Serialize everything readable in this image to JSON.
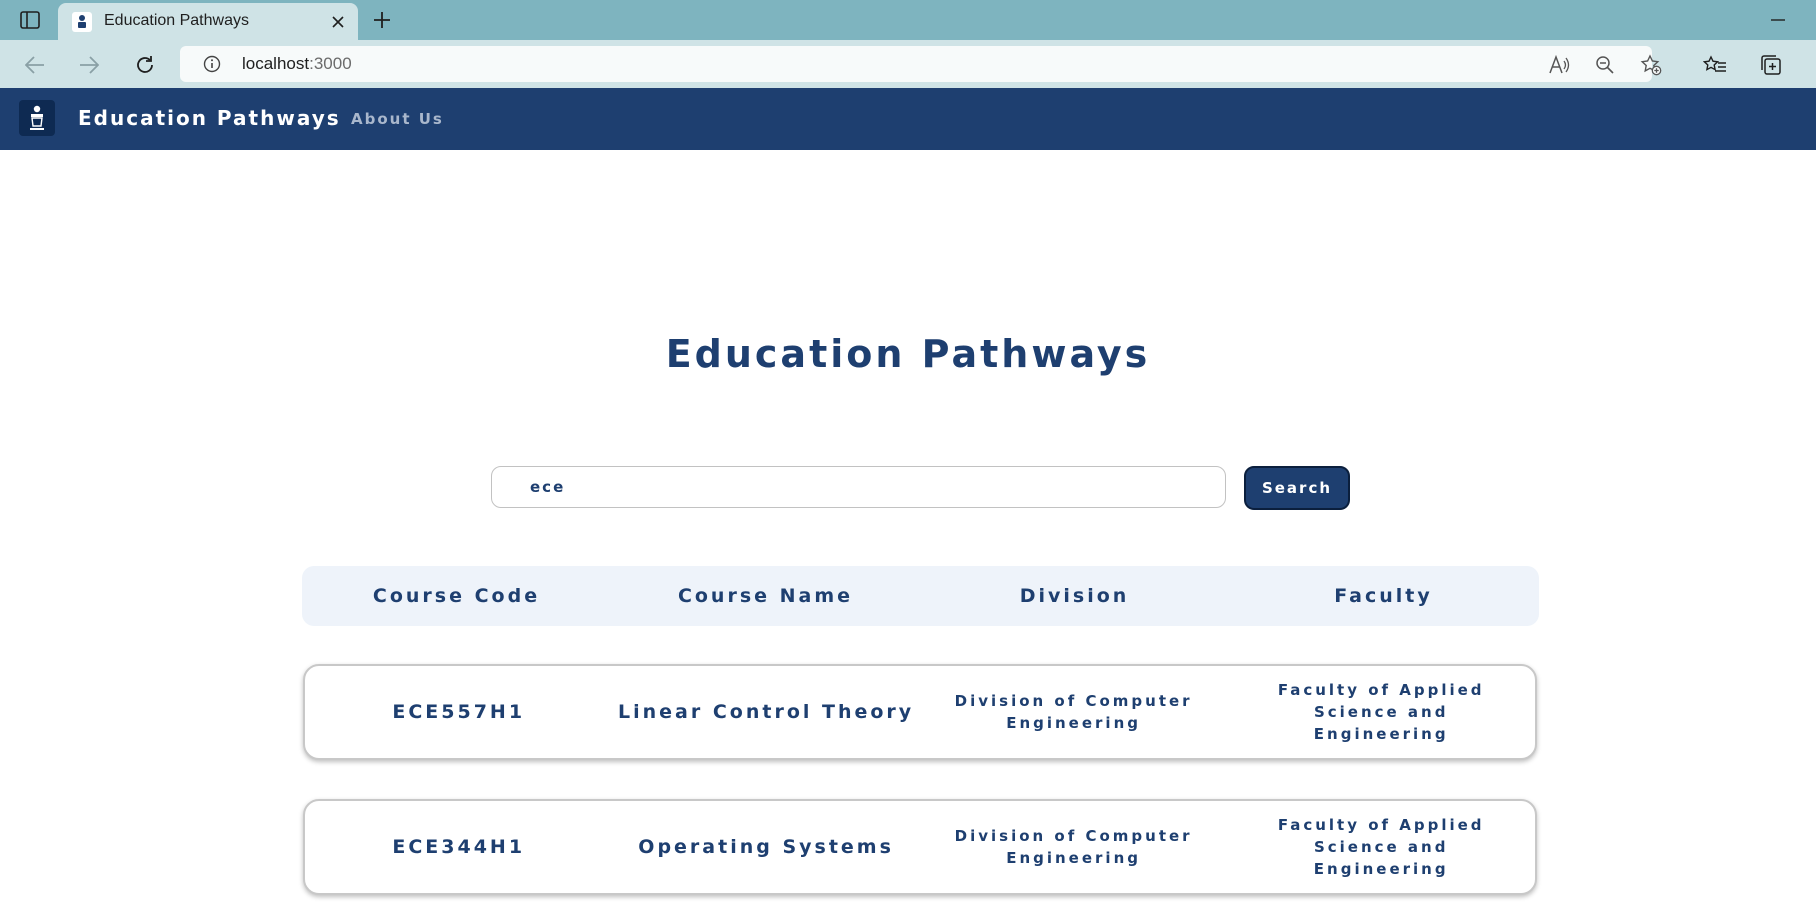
{
  "browser": {
    "tab_title": "Education Pathways",
    "address_host": "localhost",
    "address_port": ":3000"
  },
  "navbar": {
    "brand": "Education Pathways",
    "about_link": "About Us"
  },
  "main": {
    "title": "Education Pathways",
    "search": {
      "value": "ece",
      "button_label": "Search"
    },
    "table": {
      "headers": [
        "Course Code",
        "Course Name",
        "Division",
        "Faculty"
      ],
      "rows": [
        {
          "code": "ECE557H1",
          "name": "Linear Control Theory",
          "division": "Division of Computer Engineering",
          "faculty": "Faculty of Applied Science and Engineering"
        },
        {
          "code": "ECE344H1",
          "name": "Operating Systems",
          "division": "Division of Computer Engineering",
          "faculty": "Faculty of Applied Science and Engineering"
        }
      ]
    }
  },
  "colors": {
    "brand_navy": "#1e3f70",
    "header_bg": "#eef3fa",
    "browser_tabbar": "#7eb4bf",
    "browser_toolbar": "#cfe3e6"
  }
}
